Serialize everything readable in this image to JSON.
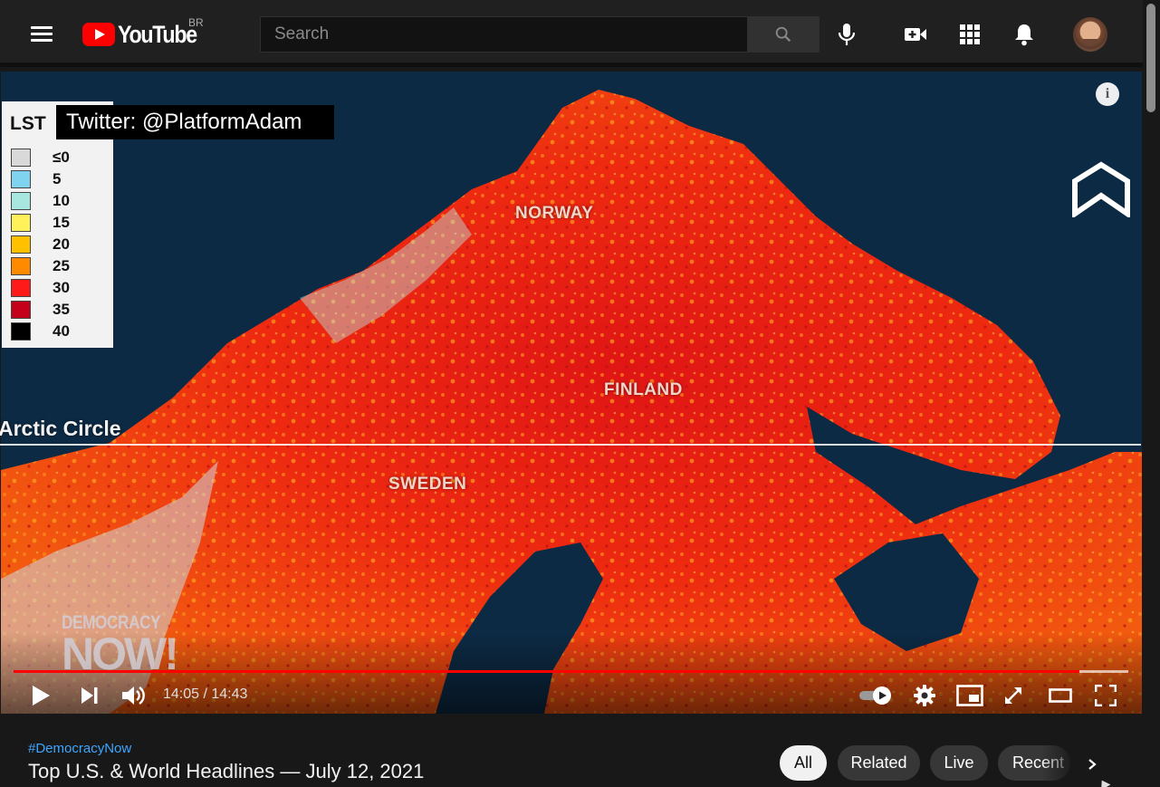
{
  "masthead": {
    "logo_text": "YouTube",
    "country_code": "BR",
    "search_placeholder": "Search",
    "icons": [
      "menu-icon",
      "search-icon",
      "mic-icon",
      "create-video-icon",
      "apps-grid-icon",
      "notifications-bell-icon"
    ]
  },
  "video": {
    "legend_title": "LST",
    "legend": [
      {
        "label": "≤0",
        "color": "#d9d9d9"
      },
      {
        "label": "5",
        "color": "#7fd3ee"
      },
      {
        "label": "10",
        "color": "#a8e6e0"
      },
      {
        "label": "15",
        "color": "#fff15a"
      },
      {
        "label": "20",
        "color": "#ffc000"
      },
      {
        "label": "25",
        "color": "#ff8a00"
      },
      {
        "label": "30",
        "color": "#ff1a1a"
      },
      {
        "label": "35",
        "color": "#c4001a"
      },
      {
        "label": "40",
        "color": "#000000"
      }
    ],
    "twitter_tag": "Twitter: @PlatformAdam",
    "map_labels": {
      "norway": "NORWAY",
      "finland": "FINLAND",
      "sweden": "SWEDEN"
    },
    "arctic_label": "Arctic Circle",
    "watermark_line1": "DEMOCRACY",
    "watermark_line2": "NOW!",
    "info_symbol": "i"
  },
  "player": {
    "current_time": "14:05",
    "duration": "14:43",
    "time_display": "14:05 / 14:43",
    "played_fraction": 0.956,
    "loaded_fraction": 1.0,
    "icons": [
      "play-icon",
      "next-icon",
      "volume-icon",
      "autoplay-toggle-icon",
      "settings-gear-icon",
      "miniplayer-icon",
      "fullscreen-expand-icon",
      "theater-mode-icon",
      "fullscreen-icon"
    ]
  },
  "below": {
    "hashtag": "#DemocracyNow",
    "title": "Top U.S. & World Headlines — July 12, 2021",
    "chips": [
      "All",
      "Related",
      "Live",
      "Recent"
    ],
    "active_chip": "All"
  },
  "colors": {
    "accent_red": "#ff0000",
    "link_blue": "#3ea6ff",
    "background": "#181818"
  }
}
